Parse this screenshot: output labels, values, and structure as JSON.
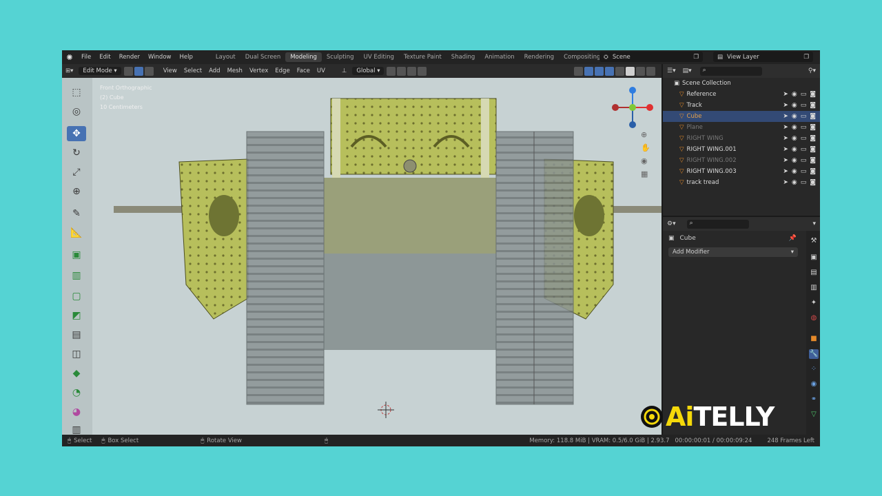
{
  "app": {
    "menu": [
      "File",
      "Edit",
      "Render",
      "Window",
      "Help"
    ],
    "workspaces": [
      "Layout",
      "Dual Screen",
      "Modeling",
      "Sculpting",
      "UV Editing",
      "Texture Paint",
      "Shading",
      "Animation",
      "Rendering",
      "Compositing"
    ],
    "active_workspace": "Modeling",
    "scene_label": "Scene",
    "view_layer_label": "View Layer"
  },
  "header": {
    "mode": "Edit Mode",
    "menus": [
      "View",
      "Select",
      "Add",
      "Mesh",
      "Vertex",
      "Edge",
      "Face",
      "UV"
    ],
    "orientation": "Global"
  },
  "viewport": {
    "overlay_lines": [
      "Front Orthographic",
      "(2) Cube",
      "10 Centimeters"
    ]
  },
  "outliner": {
    "collection": "Scene Collection",
    "rows": [
      {
        "name": "Reference",
        "selected": false,
        "dim": false
      },
      {
        "name": "Track",
        "selected": false,
        "dim": false
      },
      {
        "name": "Cube",
        "selected": true,
        "dim": false
      },
      {
        "name": "Plane",
        "selected": false,
        "dim": true
      },
      {
        "name": "RIGHT WING",
        "selected": false,
        "dim": true
      },
      {
        "name": "RIGHT WING.001",
        "selected": false,
        "dim": false
      },
      {
        "name": "RIGHT WING.002",
        "selected": false,
        "dim": true
      },
      {
        "name": "RIGHT WING.003",
        "selected": false,
        "dim": false
      },
      {
        "name": "track tread",
        "selected": false,
        "dim": false
      }
    ]
  },
  "properties": {
    "object_name": "Cube",
    "add_modifier": "Add Modifier"
  },
  "statusbar": {
    "select": "Select",
    "box_select": "Box Select",
    "rotate_view": "Rotate View",
    "stats": "Memory: 118.8 MiB | VRAM: 0.5/6.0 GiB | 2.93.7",
    "time": "00:00:00:01 / 00:00:09:24",
    "frames_left": "248 Frames Left"
  },
  "watermark": {
    "prefix": "Ai",
    "suffix": "TELLY"
  }
}
